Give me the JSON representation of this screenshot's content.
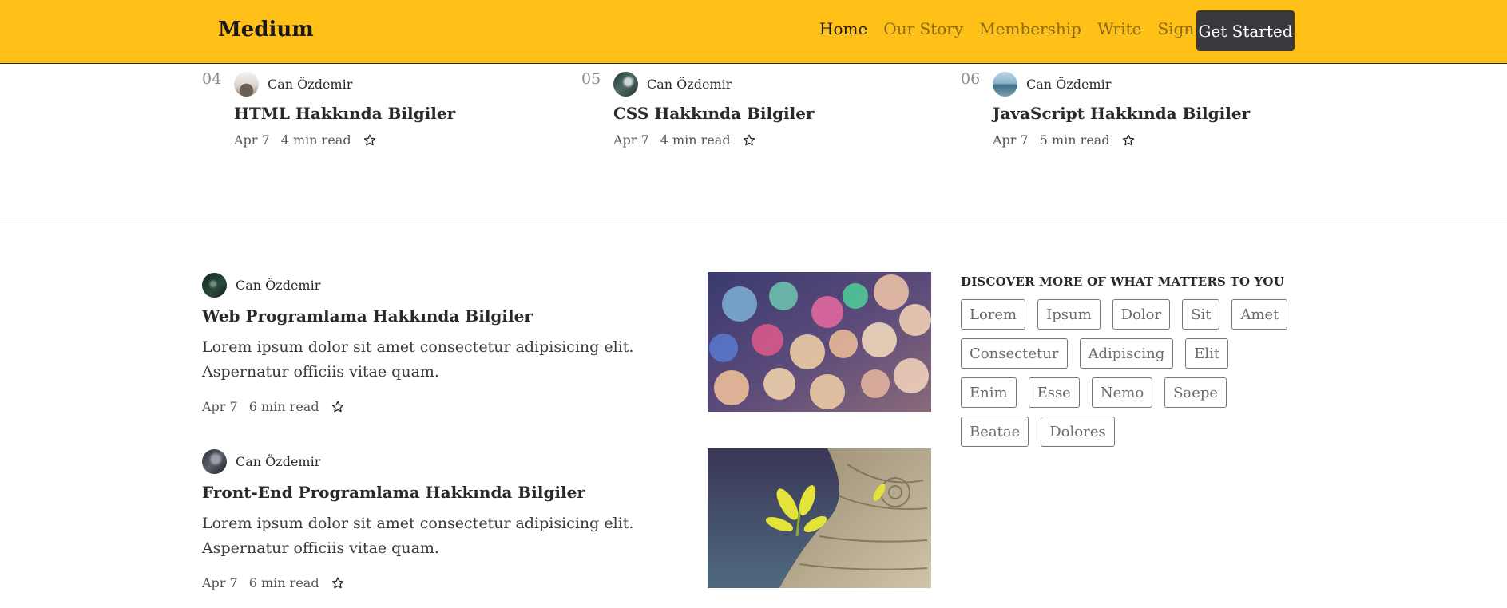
{
  "header": {
    "logo": "Medium",
    "nav": [
      "Home",
      "Our Story",
      "Membership",
      "Write",
      "Sign In"
    ],
    "cta": "Get Started",
    "bg_color": "#ffc017"
  },
  "trending": [
    {
      "num": "04",
      "author": "Can Özdemir",
      "title": "HTML Hakkında Bilgiler",
      "date": "Apr 7",
      "read": "4 min read"
    },
    {
      "num": "05",
      "author": "Can Özdemir",
      "title": "CSS Hakkında Bilgiler",
      "date": "Apr 7",
      "read": "4 min read"
    },
    {
      "num": "06",
      "author": "Can Özdemir",
      "title": "JavaScript Hakkında Bilgiler",
      "date": "Apr 7",
      "read": "5 min read"
    }
  ],
  "posts": [
    {
      "author": "Can Özdemir",
      "title": "Web Programlama Hakkında Bilgiler",
      "excerpt": "Lorem ipsum dolor sit amet consectetur adipisicing elit. Aspernatur officiis vitae quam.",
      "date": "Apr 7",
      "read": "6 min read"
    },
    {
      "author": "Can Özdemir",
      "title": "Front-End Programlama Hakkında Bilgiler",
      "excerpt": "Lorem ipsum dolor sit amet consectetur adipisicing elit. Aspernatur officiis vitae quam.",
      "date": "Apr 7",
      "read": "6 min read"
    }
  ],
  "sidebar": {
    "heading": "DISCOVER MORE OF WHAT MATTERS TO YOU",
    "tags": [
      "Lorem",
      "Ipsum",
      "Dolor",
      "Sit",
      "Amet",
      "Consectetur",
      "Adipiscing",
      "Elit",
      "Enim",
      "Esse",
      "Nemo",
      "Saepe",
      "Beatae",
      "Dolores"
    ]
  }
}
